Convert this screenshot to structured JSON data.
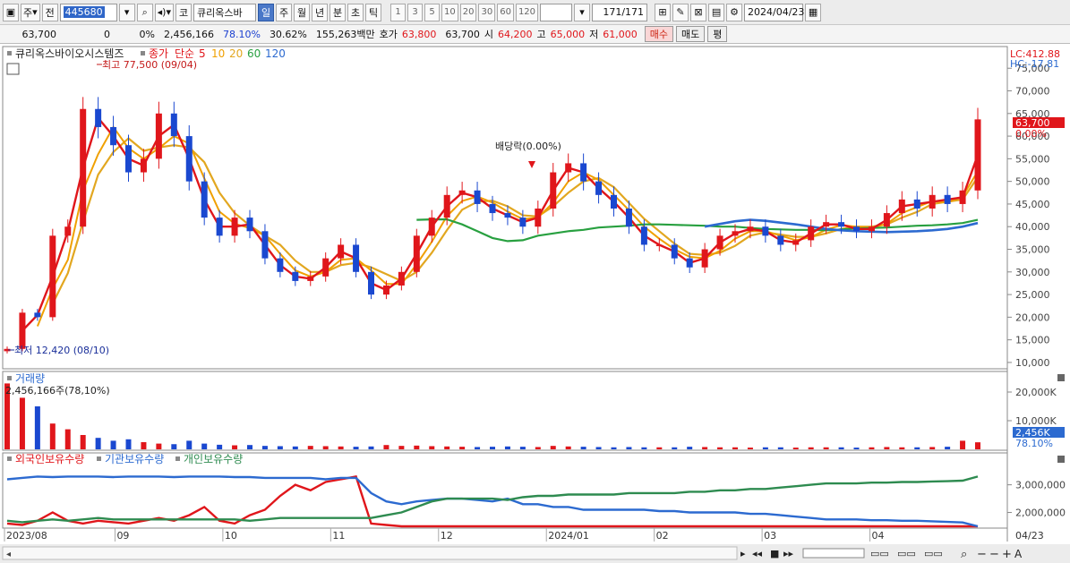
{
  "toolbar": {
    "market": "주",
    "prev": "전",
    "code": "445680",
    "kind": "코",
    "name": "큐리옥스바",
    "periods": [
      "일",
      "주",
      "월",
      "년",
      "분",
      "초",
      "틱"
    ],
    "active_period": "일",
    "intervals": [
      "1",
      "3",
      "5",
      "10",
      "20",
      "30",
      "60",
      "120"
    ],
    "count": "171",
    "total": "/171",
    "date": "2024/04/23"
  },
  "quote": {
    "price": "63,700",
    "change": "0",
    "change_pct": "0%",
    "volume": "2,456,166",
    "turnover_pct": "78.10%",
    "rate": "30.62%",
    "amount": "155,263백만",
    "ask_label": "호가",
    "ask1": "63,800",
    "ask2": "63,700",
    "open_label": "시",
    "open": "64,200",
    "high_label": "고",
    "high": "65,000",
    "low_label": "저",
    "low": "61,000",
    "buy": "매수",
    "sell": "매도",
    "avg": "평"
  },
  "colors": {
    "up": "#e0161b",
    "down": "#1a48d0",
    "ma5": "#e0161b",
    "ma10": "#f0a000",
    "ma20": "#e2a720",
    "ma60": "#28a040",
    "ma120": "#2c6ad0"
  },
  "chart_data": [
    {
      "type": "candlestick",
      "title": "큐리옥스바이오시스템즈",
      "legend": {
        "price_label": "종가",
        "ma_label": "단순",
        "ma": [
          "5",
          "10",
          "20",
          "60",
          "120"
        ]
      },
      "x_labels": [
        "2023/08",
        "09",
        "10",
        "11",
        "12",
        "2024/01",
        "02",
        "03",
        "04"
      ],
      "y_ticks": [
        "75,000",
        "70,000",
        "65,000",
        "60,000",
        "55,000",
        "50,000",
        "45,000",
        "40,000",
        "35,000",
        "30,000",
        "25,000",
        "20,000",
        "15,000",
        "10,000"
      ],
      "ylim": [
        9000,
        79000
      ],
      "right_info": {
        "lc": "LC:412.88",
        "hc": "HC:-17.81",
        "last_price": "63,700",
        "last_pct": "0.00%"
      },
      "annotations": {
        "high": "최고 77,500 (09/04)",
        "low": "최저 12,420 (08/10)",
        "dividend": "배당락(0.00%)"
      },
      "close_points": [
        13000,
        21000,
        20000,
        38000,
        40000,
        66000,
        62000,
        58000,
        52000,
        55000,
        65000,
        60000,
        50000,
        42000,
        38000,
        42000,
        39000,
        33000,
        30000,
        28000,
        29000,
        33000,
        36000,
        30000,
        25000,
        27000,
        30000,
        38000,
        42000,
        47000,
        48000,
        45000,
        43000,
        42000,
        40000,
        44000,
        52000,
        54000,
        50000,
        47000,
        44000,
        40000,
        36000,
        36000,
        33000,
        31000,
        35000,
        38000,
        39000,
        40000,
        38000,
        36000,
        37000,
        40000,
        41000,
        40000,
        39000,
        40000,
        43000,
        46000,
        44000,
        47000,
        45000,
        48000,
        63700
      ],
      "ma_lines": {
        "ma60": [
          null,
          null,
          null,
          null,
          null,
          null,
          null,
          null,
          null,
          null,
          null,
          null,
          null,
          null,
          null,
          null,
          null,
          null,
          null,
          null,
          null,
          null,
          null,
          null,
          null,
          null,
          null,
          41500,
          41600,
          41600,
          40500,
          39000,
          37500,
          36800,
          37000,
          38000,
          38500,
          39000,
          39300,
          39800,
          40000,
          40200,
          40500,
          40500,
          40400,
          40300,
          40200,
          40000,
          40000,
          39700,
          39500,
          39400,
          39300,
          39300,
          39200,
          39400,
          39600,
          39700,
          39800,
          40000,
          40200,
          40300,
          40500,
          40800,
          41500
        ],
        "ma120": [
          null,
          null,
          null,
          null,
          null,
          null,
          null,
          null,
          null,
          null,
          null,
          null,
          null,
          null,
          null,
          null,
          null,
          null,
          null,
          null,
          null,
          null,
          null,
          null,
          null,
          null,
          null,
          null,
          null,
          null,
          null,
          null,
          null,
          null,
          null,
          null,
          null,
          null,
          null,
          null,
          null,
          null,
          null,
          null,
          null,
          null,
          40000,
          40600,
          41200,
          41500,
          41300,
          40900,
          40500,
          40000,
          39500,
          39200,
          39000,
          38900,
          38800,
          38900,
          39000,
          39200,
          39500,
          40000,
          40800
        ]
      }
    },
    {
      "type": "bar",
      "title": "거래량",
      "value_label": "2,456,166주(78,10%)",
      "y_ticks": [
        "20,000K",
        "10,000K"
      ],
      "last_label": "2,456K",
      "last_pct": "78.10%",
      "values_k": [
        23000,
        18000,
        15000,
        9000,
        7000,
        5000,
        4000,
        3000,
        3500,
        2500,
        2000,
        1800,
        3000,
        2000,
        1600,
        1400,
        1500,
        1200,
        1100,
        1000,
        1200,
        1100,
        1000,
        900,
        1000,
        1500,
        1200,
        1300,
        1100,
        1000,
        900,
        800,
        900,
        1000,
        900,
        800,
        1200,
        1000,
        900,
        800,
        700,
        800,
        700,
        700,
        700,
        900,
        800,
        700,
        700,
        600,
        700,
        700,
        600,
        700,
        700,
        700,
        600,
        700,
        800,
        700,
        700,
        800,
        900,
        3000,
        2456
      ]
    },
    {
      "type": "line",
      "series_labels": [
        "외국인보유수량",
        "기관보유수량",
        "개인보유수량"
      ],
      "y_ticks": [
        "3,000,000",
        "2,000,000"
      ],
      "ylim": [
        1500000,
        3700000
      ],
      "series": [
        {
          "name": "외국인보유수량",
          "color": "#e0161b",
          "values": [
            1600000,
            1550000,
            1700000,
            2000000,
            1700000,
            1600000,
            1700000,
            1650000,
            1600000,
            1700000,
            1800000,
            1700000,
            1900000,
            2200000,
            1700000,
            1600000,
            1900000,
            2100000,
            2600000,
            3000000,
            2800000,
            3100000,
            3200000,
            3300000,
            1600000,
            1550000,
            1500000,
            1500000,
            1500000,
            1500000,
            1500000,
            1500000,
            1500000,
            1500000,
            1500000,
            1500000,
            1500000,
            1500000,
            1500000,
            1500000,
            1500000,
            1500000,
            1500000,
            1500000,
            1500000,
            1500000,
            1500000,
            1500000,
            1500000,
            1500000,
            1500000,
            1500000,
            1500000,
            1500000,
            1500000,
            1500000,
            1500000,
            1500000,
            1500000,
            1500000,
            1500000,
            1500000,
            1500000,
            1500000,
            1500000
          ]
        },
        {
          "name": "기관보유수량",
          "color": "#2c6ad0",
          "values": [
            3200000,
            3250000,
            3300000,
            3280000,
            3300000,
            3300000,
            3300000,
            3280000,
            3300000,
            3300000,
            3300000,
            3280000,
            3300000,
            3300000,
            3300000,
            3280000,
            3280000,
            3250000,
            3250000,
            3250000,
            3250000,
            3200000,
            3250000,
            3250000,
            2700000,
            2400000,
            2300000,
            2400000,
            2450000,
            2500000,
            2500000,
            2450000,
            2400000,
            2500000,
            2300000,
            2300000,
            2200000,
            2200000,
            2100000,
            2100000,
            2100000,
            2100000,
            2100000,
            2050000,
            2050000,
            2000000,
            2000000,
            2000000,
            2000000,
            1950000,
            1950000,
            1900000,
            1850000,
            1800000,
            1750000,
            1750000,
            1750000,
            1720000,
            1720000,
            1700000,
            1700000,
            1680000,
            1660000,
            1640000,
            1500000
          ]
        },
        {
          "name": "개인보유수량",
          "color": "#2e8b50",
          "values": [
            1700000,
            1650000,
            1700000,
            1750000,
            1700000,
            1750000,
            1800000,
            1750000,
            1750000,
            1750000,
            1750000,
            1750000,
            1750000,
            1750000,
            1750000,
            1750000,
            1700000,
            1750000,
            1800000,
            1800000,
            1800000,
            1800000,
            1800000,
            1800000,
            1800000,
            1900000,
            2000000,
            2200000,
            2400000,
            2500000,
            2500000,
            2500000,
            2500000,
            2450000,
            2550000,
            2600000,
            2600000,
            2650000,
            2650000,
            2650000,
            2650000,
            2700000,
            2700000,
            2700000,
            2700000,
            2750000,
            2750000,
            2800000,
            2800000,
            2850000,
            2850000,
            2900000,
            2950000,
            3000000,
            3050000,
            3050000,
            3050000,
            3080000,
            3080000,
            3100000,
            3100000,
            3120000,
            3130000,
            3150000,
            3300000
          ]
        }
      ]
    }
  ],
  "bottom": {
    "date_label": "04/23"
  }
}
